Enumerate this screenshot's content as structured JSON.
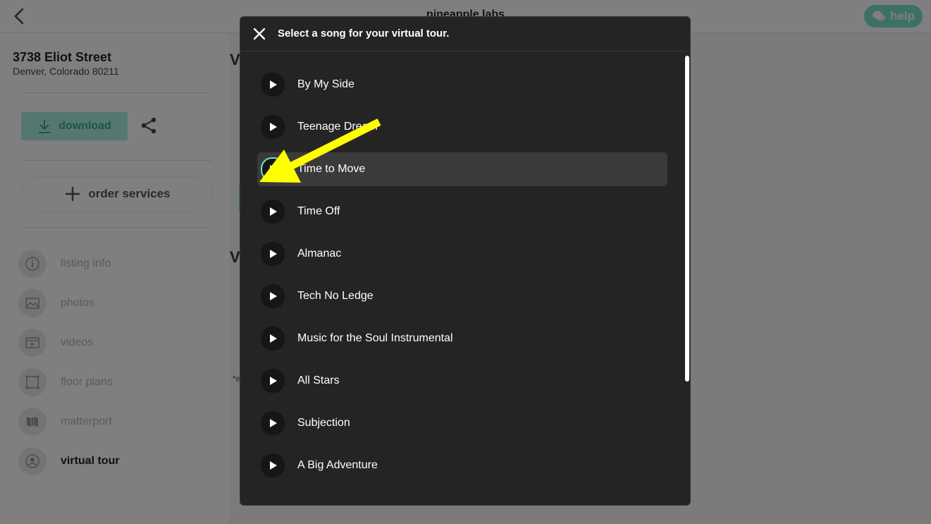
{
  "topbar": {
    "brand": "pineapple labs",
    "help_label": "help"
  },
  "listing": {
    "street": "3738 Eliot Street",
    "city": "Denver, Colorado 80211"
  },
  "actions": {
    "download_label": "download",
    "order_label": "order services"
  },
  "nav": [
    {
      "label": "listing info",
      "icon": "info-icon"
    },
    {
      "label": "photos",
      "icon": "photo-icon"
    },
    {
      "label": "videos",
      "icon": "video-icon"
    },
    {
      "label": "floor plans",
      "icon": "floor-plan-icon"
    },
    {
      "label": "matterport",
      "icon": "matterport-icon"
    },
    {
      "label": "virtual tour",
      "icon": "virtual-tour-icon",
      "active": true
    }
  ],
  "main": {
    "heading_1": "V",
    "heading_2": "V",
    "note": "*e"
  },
  "modal": {
    "title": "Select a song for your virtual tour.",
    "songs": [
      {
        "title": "By My Side"
      },
      {
        "title": "Teenage Dream"
      },
      {
        "title": "Time to Move",
        "highlighted": true
      },
      {
        "title": "Time Off"
      },
      {
        "title": "Almanac"
      },
      {
        "title": "Tech No Ledge"
      },
      {
        "title": "Music for the Soul Instrumental"
      },
      {
        "title": "All Stars"
      },
      {
        "title": "Subjection"
      },
      {
        "title": "A Big Adventure"
      }
    ]
  },
  "colors": {
    "accent": "#7be0cd",
    "modal_bg": "#242424",
    "annotation_arrow": "#ffff00"
  }
}
